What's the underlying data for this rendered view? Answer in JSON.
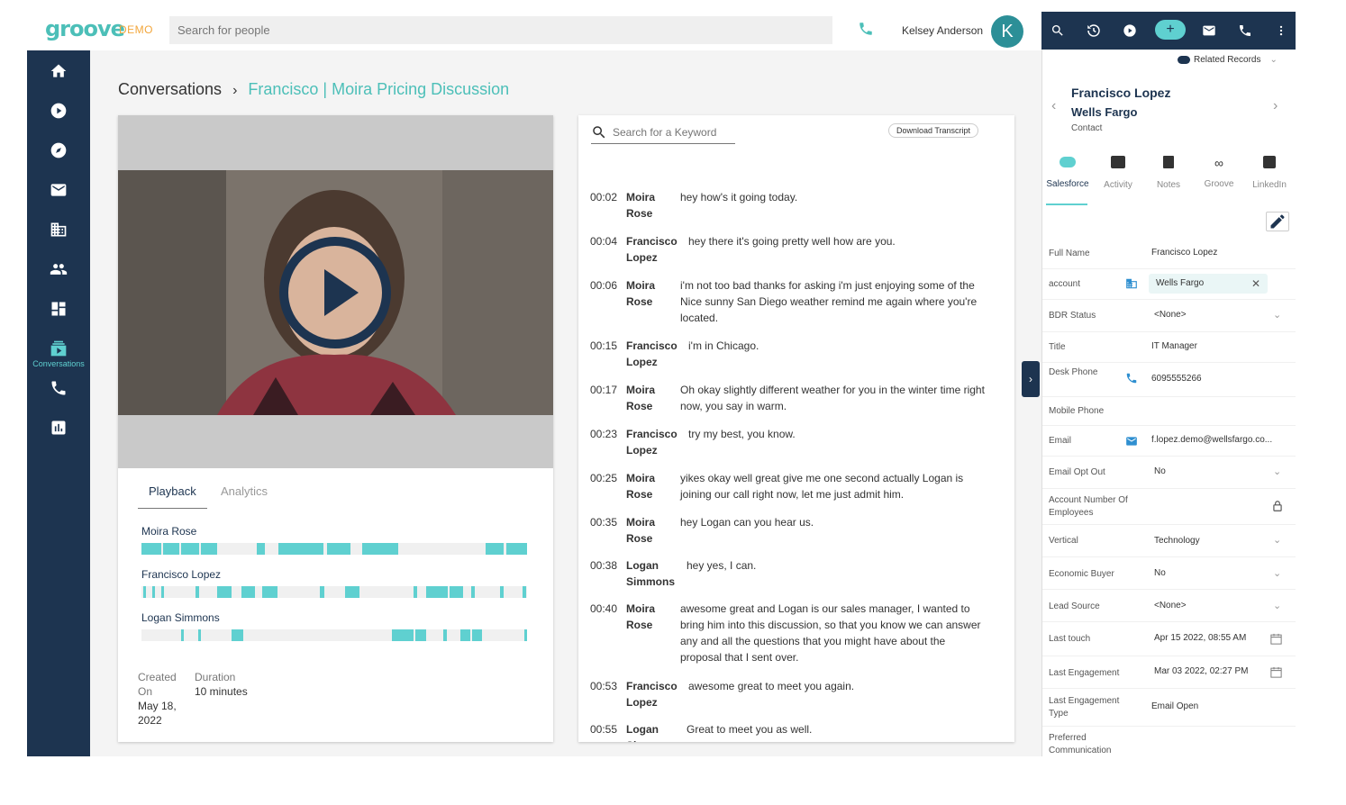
{
  "app": {
    "logo": "groove",
    "badge": "DEMO"
  },
  "search": {
    "placeholder": "Search for people"
  },
  "user": {
    "name": "Kelsey Anderson",
    "initial": "K"
  },
  "leftnav": {
    "active_label": "Conversations",
    "items": [
      "home-icon",
      "play-icon",
      "compass-icon",
      "mail-icon",
      "building-icon",
      "people-icon",
      "dashboard-icon",
      "conversations-icon",
      "phone-icon",
      "analytics-icon"
    ]
  },
  "breadcrumb": {
    "root": "Conversations",
    "separator": "›",
    "current": "Francisco | Moira Pricing Discussion"
  },
  "playback": {
    "tabs": [
      "Playback",
      "Analytics"
    ],
    "speakers": [
      {
        "name": "Moira Rose"
      },
      {
        "name": "Francisco Lopez"
      },
      {
        "name": "Logan Simmons"
      }
    ],
    "created_label": "Created On",
    "created_value": "May 18, 2022",
    "duration_label": "Duration",
    "duration_value": "10 minutes"
  },
  "transcript": {
    "search_placeholder": "Search for a Keyword",
    "download_label": "Download Transcript",
    "lines": [
      {
        "time": "00:02",
        "speaker": "Moira Rose",
        "text": "hey how's it going today."
      },
      {
        "time": "00:04",
        "speaker": "Francisco Lopez",
        "text": "hey there it's going pretty well how are you."
      },
      {
        "time": "00:06",
        "speaker": "Moira Rose",
        "text": "i'm not too bad thanks for asking i'm just enjoying some of the Nice sunny San Diego weather remind me again where you're located."
      },
      {
        "time": "00:15",
        "speaker": "Francisco Lopez",
        "text": "i'm in Chicago."
      },
      {
        "time": "00:17",
        "speaker": "Moira Rose",
        "text": "Oh okay slightly different weather for you in the winter time right now, you say in warm."
      },
      {
        "time": "00:23",
        "speaker": "Francisco Lopez",
        "text": "try my best, you know."
      },
      {
        "time": "00:25",
        "speaker": "Moira Rose",
        "text": "yikes okay well great give me one second actually Logan is joining our call right now, let me just admit him."
      },
      {
        "time": "00:35",
        "speaker": "Moira Rose",
        "text": "hey Logan can you hear us."
      },
      {
        "time": "00:38",
        "speaker": "Logan Simmons",
        "text": "hey yes, I can."
      },
      {
        "time": "00:40",
        "speaker": "Moira Rose",
        "text": "awesome great and Logan is our sales manager, I wanted to bring him into this discussion, so that you know we can answer any and all the questions that you might have about the proposal that I sent over."
      },
      {
        "time": "00:53",
        "speaker": "Francisco Lopez",
        "text": "awesome great to meet you again."
      },
      {
        "time": "00:55",
        "speaker": "Logan Simmons",
        "text": "Great to meet you as well."
      }
    ]
  },
  "panel": {
    "related_label": "Related Records",
    "contact_name": "Francisco Lopez",
    "company": "Wells Fargo",
    "contact_type": "Contact",
    "tabs": [
      "Salesforce",
      "Activity",
      "Notes",
      "Groove",
      "LinkedIn"
    ],
    "fields": {
      "full_name": {
        "label": "Full Name",
        "value": "Francisco Lopez"
      },
      "account": {
        "label": "account",
        "value": "Wells Fargo"
      },
      "bdr_status": {
        "label": "BDR Status",
        "value": "<None>"
      },
      "title": {
        "label": "Title",
        "value": "IT Manager"
      },
      "desk_phone": {
        "label": "Desk Phone",
        "value": "6095555266"
      },
      "mobile_phone": {
        "label": "Mobile Phone",
        "value": ""
      },
      "email": {
        "label": "Email",
        "value": "f.lopez.demo@wellsfargo.co..."
      },
      "email_opt_out": {
        "label": "Email Opt Out",
        "value": "No"
      },
      "account_employees": {
        "label": "Account Number Of Employees",
        "value": ""
      },
      "vertical": {
        "label": "Vertical",
        "value": "Technology"
      },
      "economic_buyer": {
        "label": "Economic Buyer",
        "value": "No"
      },
      "lead_source": {
        "label": "Lead Source",
        "value": "<None>"
      },
      "last_touch": {
        "label": "Last touch",
        "value": "Apr 15 2022, 08:55 AM"
      },
      "last_engagement": {
        "label": "Last Engagement",
        "value": "Mar 03 2022, 02:27 PM"
      },
      "last_engagement_type": {
        "label": "Last Engagement Type",
        "value": "Email Open"
      },
      "preferred_comm": {
        "label": "Preferred Communication",
        "value": ""
      }
    }
  },
  "colors": {
    "navy": "#1d3450",
    "teal": "#5fd0d0",
    "brand": "#4cbfb8",
    "demo": "#f2a63b"
  }
}
